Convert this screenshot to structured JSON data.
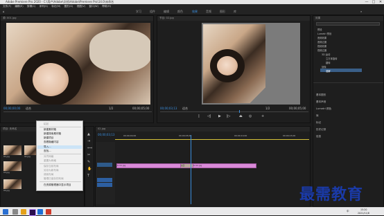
{
  "titlebar": {
    "title": "Adobe Premiere Pro 2020 - C:\\用户\\Adobe\\文档\\Adobe\\Premiere Pro\\14.0\\未命名",
    "minimize": "—",
    "maximize": "□",
    "close": "✕"
  },
  "menu": [
    "文件(F)",
    "编辑(E)",
    "剪辑(C)",
    "序列(S)",
    "标记(M)",
    "图形(G)",
    "视图(V)",
    "窗口(W)",
    "帮助(H)"
  ],
  "workspaces": [
    "学习",
    "组件",
    "编辑",
    "颜色",
    "效果",
    "音频",
    "图形",
    "库"
  ],
  "active_workspace": "效果",
  "source_panel": {
    "tab": "源: 001.jpg",
    "timecode": "00;00;00;00",
    "fit": "适合",
    "duration": "00;00;05;00",
    "ratio": "1/2"
  },
  "program_panel": {
    "tab": "节目: 02.jpg",
    "timecode": "00;00;03;13",
    "fit": "适合",
    "ratio": "1/2",
    "duration": "00;00;05;00"
  },
  "project_panel": {
    "tab": "项目: 未命名",
    "search_placeholder": "",
    "item_count": "",
    "items": [
      {
        "name": "01.jpg",
        "dur": "5;00"
      },
      {
        "name": "02.jpg",
        "dur": "5;00"
      },
      {
        "name": "03.jpg",
        "dur": "5;00"
      },
      {
        "name": "04.jpg",
        "dur": "5;00"
      }
    ]
  },
  "context_menu": {
    "items": [
      {
        "label": "粘贴",
        "disabled": true
      },
      {
        "label": "新建素材箱",
        "disabled": false
      },
      {
        "label": "新建搜索素材箱",
        "disabled": false
      },
      {
        "label": "新建项目",
        "disabled": false
      },
      {
        "label": "查看隐藏内容",
        "disabled": false
      },
      {
        "label": "导入...",
        "disabled": false,
        "highlight": true
      },
      {
        "label": "查找...",
        "disabled": false
      },
      {
        "label": "对齐网格",
        "disabled": true
      },
      {
        "label": "重置为网格",
        "disabled": true
      },
      {
        "label": "保存当前布局",
        "disabled": true
      },
      {
        "label": "另存为新布局",
        "disabled": true
      },
      {
        "label": "调用布局",
        "disabled": true
      },
      {
        "label": "管理已保存的布局",
        "disabled": true
      },
      {
        "label": "在资源管理器中显示项目",
        "disabled": false
      }
    ]
  },
  "timeline": {
    "tab": "02.jpg",
    "timecode": "00;00;03;13",
    "ruler": [
      "00;00;00;00",
      "00;00;05;00",
      "00;00;10;00",
      "00;00;15;00"
    ],
    "clips": [
      {
        "label": "fx  01.jpg"
      },
      {
        "label": "交叉"
      },
      {
        "label": "fx  02.jpg"
      }
    ]
  },
  "effects_panel": {
    "tab": "效果",
    "tree": [
      "预设",
      "Lumetri 预设",
      "音频效果",
      "音频过渡",
      "视频效果",
      "视频过渡",
      "3D 运动",
      "立方体旋转",
      "翻转",
      "划像",
      "溶解"
    ],
    "sections": [
      "基本图形",
      "基本声音",
      "Lumetri 颜色",
      "库",
      "标记",
      "历史记录",
      "信息"
    ]
  },
  "taskbar": {
    "time": "15:20",
    "date": "2021/11/8",
    "lang": "中"
  },
  "watermark": "最需教育",
  "colors": {
    "accent": "#3a8fe0",
    "clip": "#d98ad8",
    "playhead": "#3a8fe0"
  }
}
